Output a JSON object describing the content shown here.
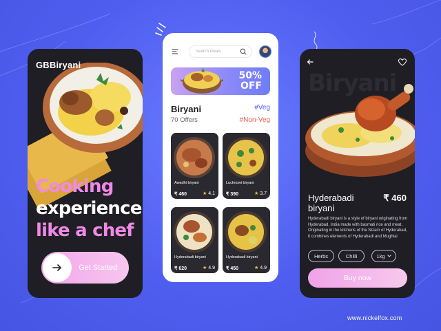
{
  "onboarding": {
    "logo": "GBBiryani",
    "headline_line1": "Cooking",
    "headline_line2": "experience",
    "headline_line3": "like a chef",
    "cta_label": "Get Started"
  },
  "home": {
    "search_placeholder": "Search meals",
    "promo_line1": "50%",
    "promo_line2": "OFF",
    "section_title": "Biryani",
    "section_subtitle": "70 Offers",
    "filter_veg": "#Veg",
    "filter_nonveg": "#Non-Veg",
    "items": [
      {
        "name": "Awadhi biryani",
        "price": "₹ 460",
        "rating": "4.1"
      },
      {
        "name": "Lucknowi biryani",
        "price": "₹ 390",
        "rating": "3.7"
      },
      {
        "name": "Hyderabadi biryani",
        "price": "₹ 620",
        "rating": "4.9"
      },
      {
        "name": "Hyderabadi biryani",
        "price": "₹ 450",
        "rating": "4.9"
      }
    ]
  },
  "detail": {
    "ghost_title": "Biryani",
    "title_line1": "Hyderabadi",
    "title_line2": "biryani",
    "price": "₹ 460",
    "description": "Hyderabadi biryani is a style of biryani originating from Hyderabad, India made with basmati rice and meat. Originating in the kitchens of the Nizam of Hyderabad, it combines elements of Hyderabadi and Mughlai",
    "chips": [
      "Herbs",
      "Chilli",
      "1kg"
    ],
    "buy_label": "Buy now"
  },
  "footer": "www.nickelfox.com",
  "colors": {
    "background": "#5563f0",
    "card_dark": "#1f1e24",
    "accent_pink": "#ee8ae6",
    "accent_blue": "#4b5cf0",
    "accent_red": "#e8604f"
  },
  "icons": [
    "arrow-right-icon",
    "menu-icon",
    "search-icon",
    "back-arrow-icon",
    "heart-icon",
    "chevron-down-icon",
    "star-icon"
  ]
}
